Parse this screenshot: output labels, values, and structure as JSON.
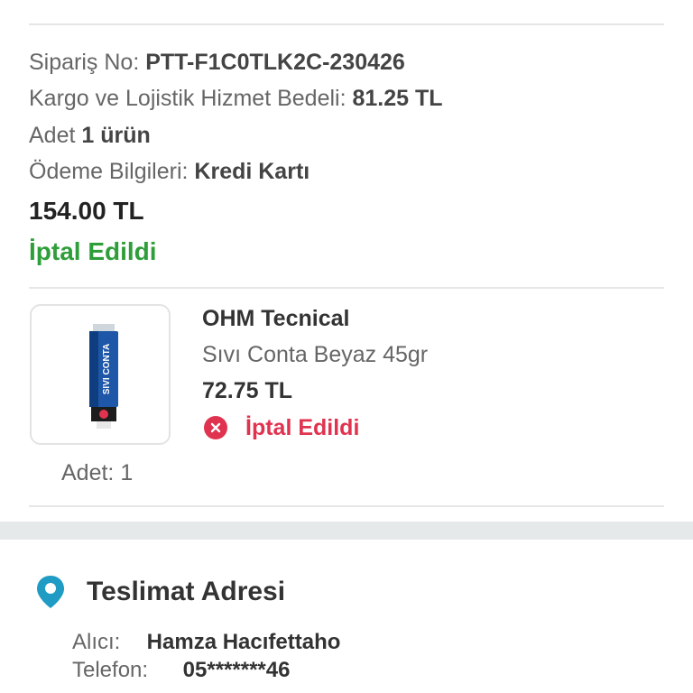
{
  "order": {
    "order_no_label": "Sipariş No:",
    "order_no_value": "PTT-F1C0TLK2C-230426",
    "shipping_label": "Kargo ve Lojistik Hizmet Bedeli:",
    "shipping_value": "81.25 TL",
    "count_label": "Adet",
    "count_value": "1 ürün",
    "payment_label": "Ödeme Bilgileri:",
    "payment_value": "Kredi Kartı",
    "total": "154.00 TL",
    "status": "İptal Edildi",
    "status_color": "#2e9e3a"
  },
  "product": {
    "image_icon": "sivi-conta-tube",
    "image_text": "SIVI CONTA",
    "brand": "OHM Tecnical",
    "name": "Sıvı Conta Beyaz 45gr",
    "price": "72.75 TL",
    "status_icon": "x-circle-icon",
    "status": "İptal Edildi",
    "status_color": "#e0334f",
    "quantity": "Adet: 1"
  },
  "delivery": {
    "icon": "location-pin-icon",
    "title": "Teslimat Adresi",
    "recipient_label": "Alıcı:",
    "recipient_value": "Hamza Hacıfettaho",
    "phone_label": "Telefon:",
    "phone_value": "05*******46"
  }
}
